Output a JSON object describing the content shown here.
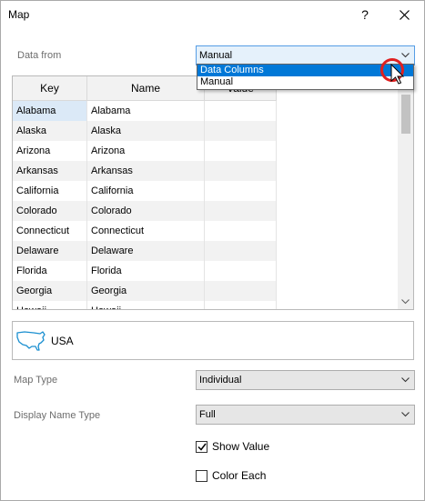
{
  "window": {
    "title": "Map",
    "help_glyph": "?"
  },
  "data_from": {
    "label": "Data from",
    "selected": "Manual",
    "options": [
      "Data Columns",
      "Manual"
    ],
    "highlighted": "Data Columns"
  },
  "grid": {
    "columns": [
      "Key",
      "Name",
      "Value"
    ],
    "rows": [
      {
        "key": "Alabama",
        "name": "Alabama",
        "value": ""
      },
      {
        "key": "Alaska",
        "name": "Alaska",
        "value": ""
      },
      {
        "key": "Arizona",
        "name": "Arizona",
        "value": ""
      },
      {
        "key": "Arkansas",
        "name": "Arkansas",
        "value": ""
      },
      {
        "key": "California",
        "name": "California",
        "value": ""
      },
      {
        "key": "Colorado",
        "name": "Colorado",
        "value": ""
      },
      {
        "key": "Connecticut",
        "name": "Connecticut",
        "value": ""
      },
      {
        "key": "Delaware",
        "name": "Delaware",
        "value": ""
      },
      {
        "key": "Florida",
        "name": "Florida",
        "value": ""
      },
      {
        "key": "Georgia",
        "name": "Georgia",
        "value": ""
      },
      {
        "key": "Hawaii",
        "name": "Hawaii",
        "value": ""
      }
    ]
  },
  "map": {
    "name": "USA",
    "icon": "usa-map-icon"
  },
  "map_type": {
    "label": "Map Type",
    "value": "Individual"
  },
  "display_name_type": {
    "label": "Display Name Type",
    "value": "Full"
  },
  "show_value": {
    "label": "Show Value",
    "checked": true
  },
  "color_each": {
    "label": "Color Each",
    "checked": false
  },
  "colors": {
    "accent": "#0078d7",
    "focus_border": "#569de5",
    "cursor_ring": "#e02020"
  }
}
